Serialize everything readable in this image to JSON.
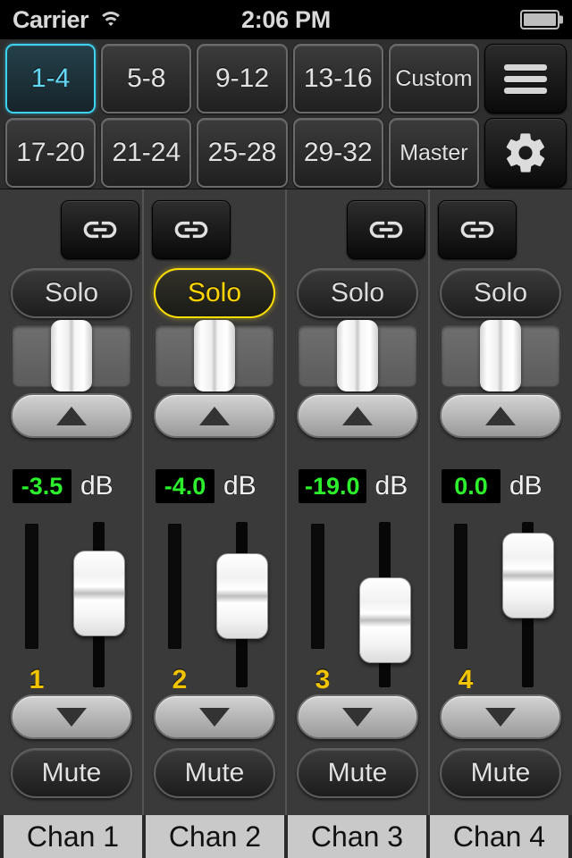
{
  "status_bar": {
    "carrier": "Carrier",
    "wifi_icon": "wifi-icon",
    "time": "2:06 PM",
    "battery_icon": "battery-icon"
  },
  "header": {
    "bank_row_1": [
      {
        "label": "1-4",
        "active": true
      },
      {
        "label": "5-8",
        "active": false
      },
      {
        "label": "9-12",
        "active": false
      },
      {
        "label": "13-16",
        "active": false
      },
      {
        "label": "Custom",
        "active": false
      }
    ],
    "bank_row_2": [
      {
        "label": "17-20",
        "active": false
      },
      {
        "label": "21-24",
        "active": false
      },
      {
        "label": "25-28",
        "active": false
      },
      {
        "label": "29-32",
        "active": false
      },
      {
        "label": "Master",
        "active": false
      }
    ],
    "menu_icon": "hamburger-menu-icon",
    "settings_icon": "gear-icon",
    "active_accent_color": "#3bd2f2"
  },
  "mixer": {
    "solo_label": "Solo",
    "mute_label": "Mute",
    "db_unit": "dB",
    "link_icon": "chain-link-icon",
    "up_icon": "triangle-up-icon",
    "down_icon": "triangle-down-icon",
    "solo_active_color": "#ffd400",
    "db_value_color": "#2bf02b",
    "channel_number_color": "#f2c400",
    "channels": [
      {
        "number": "1",
        "name": "Chan 1",
        "db": "-3.5",
        "solo": false,
        "mute": false
      },
      {
        "number": "2",
        "name": "Chan 2",
        "db": "-4.0",
        "solo": true,
        "mute": false
      },
      {
        "number": "3",
        "name": "Chan 3",
        "db": "-19.0",
        "solo": false,
        "mute": false
      },
      {
        "number": "4",
        "name": "Chan 4",
        "db": "0.0",
        "solo": false,
        "mute": false
      }
    ]
  }
}
